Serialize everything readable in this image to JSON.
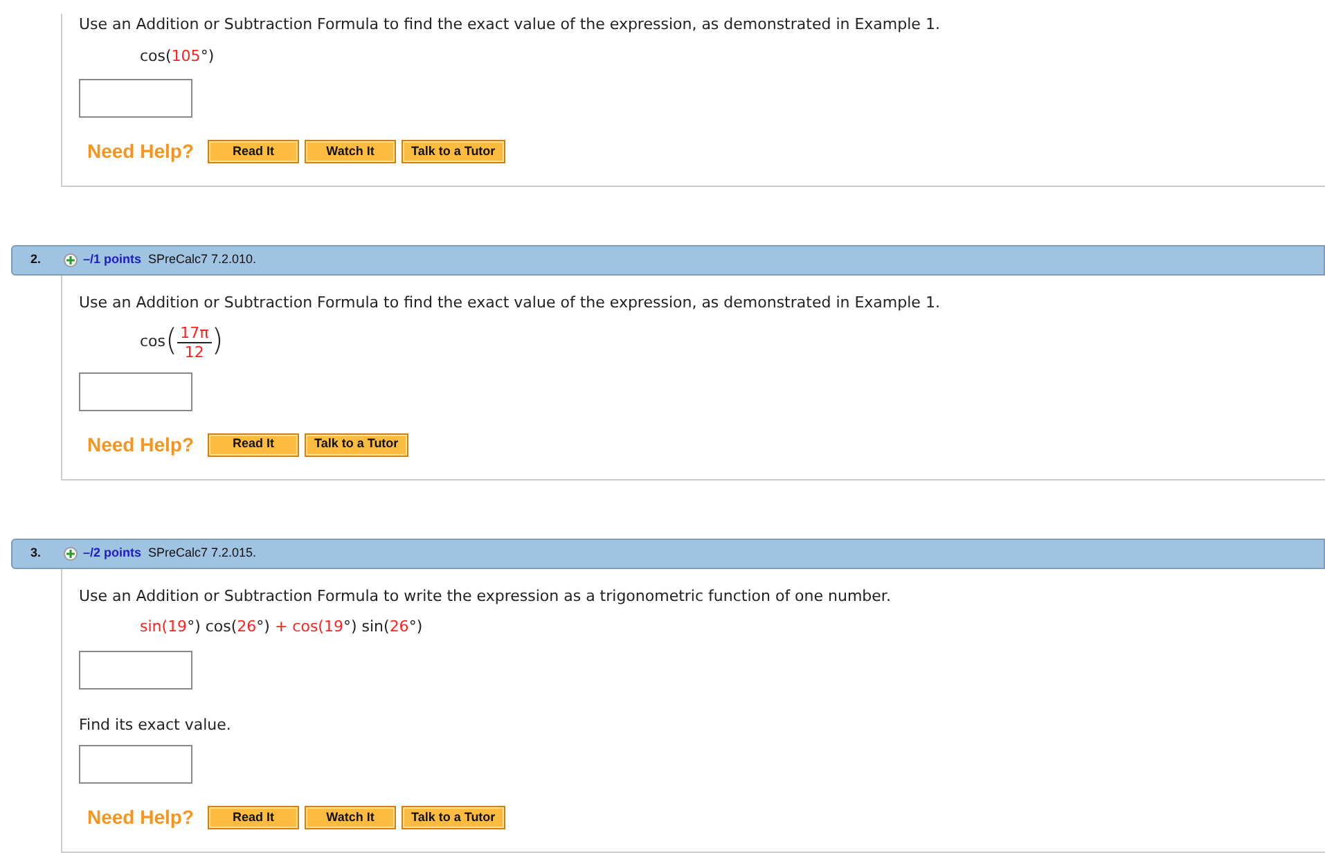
{
  "questions": [
    {
      "parts": [
        {
          "kind": "text",
          "text": "Use an Addition or Subtraction Formula to find the exact value of the expression, as demonstrated in Example 1."
        },
        {
          "kind": "expression",
          "segments": [
            {
              "text": "cos(",
              "highlight": false
            },
            {
              "text": "105",
              "highlight": true
            },
            {
              "text": "°)",
              "highlight": false
            }
          ]
        },
        {
          "kind": "input"
        }
      ],
      "help_label": "Need Help?",
      "help_buttons": [
        "Read It",
        "Watch It",
        "Talk to a Tutor"
      ]
    },
    {
      "header": {
        "number": "2.",
        "points": "–/1 points",
        "source": "SPreCalc7 7.2.010."
      },
      "parts": [
        {
          "kind": "text",
          "text": "Use an Addition or Subtraction Formula to find the exact value of the expression, as demonstrated in Example 1."
        },
        {
          "kind": "fraction",
          "func": "cos",
          "open": "(",
          "numerator": "17π",
          "denominator": "12",
          "close": ")"
        },
        {
          "kind": "input"
        }
      ],
      "help_label": "Need Help?",
      "help_buttons": [
        "Read It",
        "Talk to a Tutor"
      ]
    },
    {
      "header": {
        "number": "3.",
        "points": "–/2 points",
        "source": "SPreCalc7 7.2.015."
      },
      "parts": [
        {
          "kind": "text",
          "text": "Use an Addition or Subtraction Formula to write the expression as a trigonometric function of one number."
        },
        {
          "kind": "expression",
          "segments": [
            {
              "text": "sin(",
              "highlight": true
            },
            {
              "text": "19",
              "highlight": true
            },
            {
              "text": "°) cos(",
              "highlight": false
            },
            {
              "text": "26",
              "highlight": true
            },
            {
              "text": "°) ",
              "highlight": false
            },
            {
              "text": "+ cos(",
              "highlight": true
            },
            {
              "text": "19",
              "highlight": true
            },
            {
              "text": "°) sin(",
              "highlight": false
            },
            {
              "text": "26",
              "highlight": true
            },
            {
              "text": "°)",
              "highlight": false
            }
          ]
        },
        {
          "kind": "input"
        },
        {
          "kind": "text",
          "text": "Find its exact value."
        },
        {
          "kind": "input"
        }
      ],
      "help_label": "Need Help?",
      "help_buttons": [
        "Read It",
        "Watch It",
        "Talk to a Tutor"
      ]
    }
  ]
}
